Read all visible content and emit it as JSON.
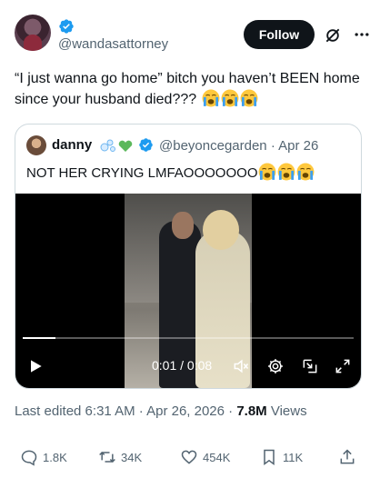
{
  "author": {
    "handle": "@wandasattorney",
    "follow_label": "Follow"
  },
  "tweet": {
    "text": "“I just wanna go home” bitch you haven’t BEEN home since your husband died???",
    "emojis": [
      "loudly-crying-face",
      "loudly-crying-face",
      "loudly-crying-face"
    ]
  },
  "quoted": {
    "name": "danny",
    "handle": "@beyoncegarden",
    "separator": "·",
    "date": "Apr 26",
    "text": "NOT HER CRYING LMFAOOOOOOO",
    "emojis": [
      "loudly-crying-face",
      "loudly-crying-face",
      "loudly-crying-face"
    ],
    "name_decorations": [
      "bubbles-emoji",
      "green-heart-emoji"
    ]
  },
  "video": {
    "time": "0:01 / 0:08",
    "progress": 0.1
  },
  "meta": {
    "edited": "Last edited 6:31 AM · Apr 26, 2026 · ",
    "views_count": "7.8M",
    "views_label": " Views"
  },
  "actions": {
    "replies": "1.8K",
    "reposts": "34K",
    "likes": "454K",
    "bookmarks": "11K"
  },
  "colors": {
    "verified": "#1d9bf0",
    "text_secondary": "#536471",
    "follow_bg": "#0f1419",
    "emoji_face": "#ffc83d",
    "emoji_tears": "#3c9ff0"
  }
}
